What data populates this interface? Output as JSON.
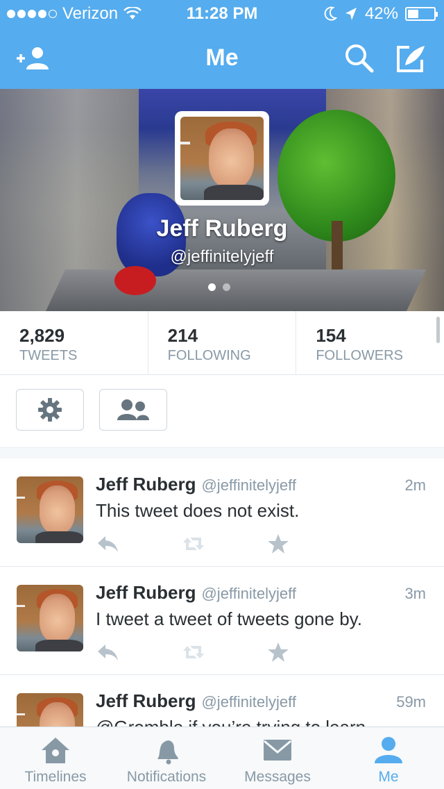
{
  "status_bar": {
    "carrier": "Verizon",
    "time": "11:28 PM",
    "battery": "42%",
    "battery_level": 0.42
  },
  "nav": {
    "title": "Me"
  },
  "profile": {
    "name": "Jeff Ruberg",
    "handle": "@jeffinitelyjeff",
    "page_count": 2,
    "current_page": 1
  },
  "stats": [
    {
      "value": "2,829",
      "label": "TWEETS"
    },
    {
      "value": "214",
      "label": "FOLLOWING"
    },
    {
      "value": "154",
      "label": "FOLLOWERS"
    }
  ],
  "tweets": [
    {
      "name": "Jeff Ruberg",
      "handle": "@jeffinitelyjeff",
      "time": "2m",
      "text": "This tweet does not exist."
    },
    {
      "name": "Jeff Ruberg",
      "handle": "@jeffinitelyjeff",
      "time": "3m",
      "text": "I tweet a tweet of tweets gone by."
    },
    {
      "name": "Jeff Ruberg",
      "handle": "@jeffinitelyjeff",
      "time": "59m",
      "text": "@Gromble if you’re trying to learn"
    }
  ],
  "tabs": [
    {
      "label": "Timelines",
      "icon": "home-icon"
    },
    {
      "label": "Notifications",
      "icon": "bell-icon"
    },
    {
      "label": "Messages",
      "icon": "envelope-icon"
    },
    {
      "label": "Me",
      "icon": "person-icon",
      "active": true
    }
  ],
  "colors": {
    "brand_blue": "#55acee",
    "text_primary": "#292f33",
    "text_secondary": "#8899a6",
    "border": "#e1e8ed"
  }
}
